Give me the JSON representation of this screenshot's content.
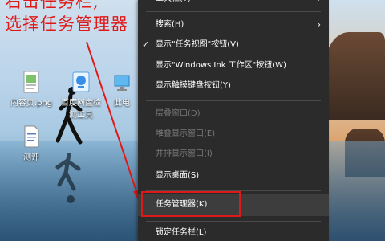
{
  "annotation": {
    "line1": "右击任务栏,",
    "line2": "选择任务管理器",
    "color": "#e11818"
  },
  "desktop_icons": [
    {
      "icon": "image-file-icon",
      "label": "内容页.png"
    },
    {
      "icon": "baidu-netdisk-icon",
      "label": "百度网盘检",
      "label2": "测工具"
    },
    {
      "icon": "this-pc-icon",
      "label": "此电"
    },
    {
      "icon": "text-file-icon",
      "label": "测评"
    }
  ],
  "context_menu": {
    "top_partial": "工具栏(T)",
    "items": [
      {
        "label": "搜索(H)",
        "submenu": true
      },
      {
        "label": "显示\"任务视图\"按钮(V)",
        "checked": true
      },
      {
        "label": "显示\"Windows Ink 工作区\"按钮(W)"
      },
      {
        "label": "显示触摸键盘按钮(Y)"
      },
      {
        "label": "层叠窗口(D)",
        "disabled": true
      },
      {
        "label": "堆叠显示窗口(E)",
        "disabled": true
      },
      {
        "label": "并排显示窗口(I)",
        "disabled": true
      },
      {
        "label": "显示桌面(S)"
      },
      {
        "label": "任务管理器(K)",
        "highlighted": true
      },
      {
        "label": "锁定任务栏(L)"
      }
    ],
    "check_glyph": "✓",
    "submenu_glyph": "›"
  }
}
